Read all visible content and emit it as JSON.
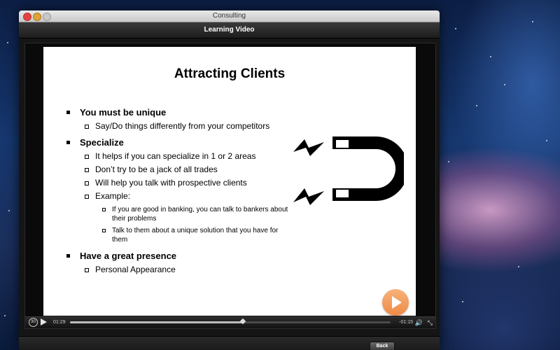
{
  "window": {
    "title": "Consulting"
  },
  "navbar": {
    "title": "Learning Video"
  },
  "slide": {
    "title": "Attracting Clients",
    "sections": [
      {
        "heading": "You must be unique",
        "items": [
          {
            "text": "Say/Do things differently from your competitors"
          }
        ]
      },
      {
        "heading": "Specialize",
        "items": [
          {
            "text": "It helps if you can specialize in 1 or 2 areas"
          },
          {
            "text": "Don’t try to be a jack of all trades"
          },
          {
            "text": "Will help you talk with prospective clients"
          },
          {
            "text": "Example:",
            "subitems": [
              "If you are good in banking, you can talk to bankers about their problems",
              "Talk to them about a unique solution that you have for them"
            ]
          }
        ]
      },
      {
        "heading": "Have a great presence",
        "items": [
          {
            "text": "Personal Appearance"
          }
        ]
      }
    ]
  },
  "player": {
    "elapsed": "01:29",
    "remaining": "-01:15",
    "progress": 0.54,
    "rewind_label": "30",
    "volume_icon": "speaker-icon",
    "fullscreen_icon": "fullscreen-icon"
  },
  "footer": {
    "back_label": "Back"
  },
  "colors": {
    "play_accent": "#ee8a48",
    "magnet": "#000000"
  }
}
